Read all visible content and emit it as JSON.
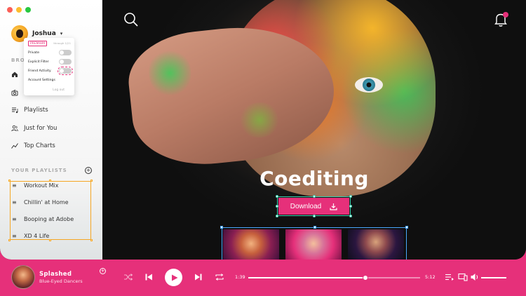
{
  "window": {
    "controls": [
      "close",
      "minimize",
      "maximize"
    ]
  },
  "user": {
    "name": "Joshua"
  },
  "menu": {
    "premium_badge": "PREMIUM",
    "plan_meta": "through 1/21",
    "rows": [
      {
        "label": "Private",
        "toggle": true
      },
      {
        "label": "Explicit Filter",
        "toggle": true
      },
      {
        "label": "Friend Activity",
        "toggle": true
      },
      {
        "label": "Account Settings",
        "toggle": false
      }
    ],
    "logout": "Log out"
  },
  "sidebar": {
    "browse_label": "BRO",
    "nav": [
      {
        "label": "Playlists",
        "icon": "playlist-icon"
      },
      {
        "label": "Just for You",
        "icon": "users-icon"
      },
      {
        "label": "Top Charts",
        "icon": "chart-line-icon"
      }
    ],
    "playlists_label": "YOUR PLAYLISTS",
    "playlists": [
      "Workout Mix",
      "Chillin' at Home",
      "Booping at Adobe",
      "XD 4 Life"
    ]
  },
  "hero": {
    "title": "Coediting",
    "download_label": "Download"
  },
  "player": {
    "song": "Splashed",
    "artist": "Blue-Eyed Dancers",
    "elapsed": "1:39",
    "duration": "5:12",
    "progress": 0.68
  },
  "colors": {
    "accent": "#e6307a",
    "selection_orange": "#f5a623",
    "selection_teal": "#3fd0b0",
    "selection_blue": "#4aa8ff"
  }
}
